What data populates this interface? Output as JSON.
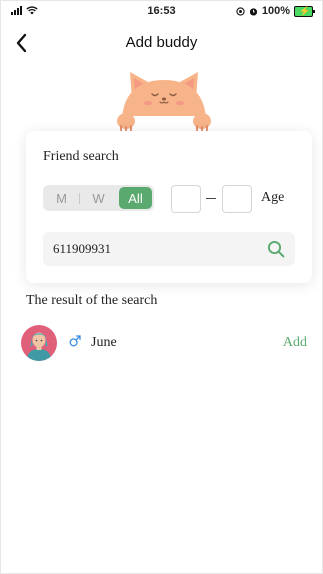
{
  "status_bar": {
    "time": "16:53",
    "battery": "100%",
    "icons": [
      "signal-icon",
      "wifi-icon",
      "location-icon",
      "alarm-icon",
      "battery-icon"
    ]
  },
  "nav": {
    "title": "Add buddy",
    "back_icon": "chevron-left-icon"
  },
  "search_card": {
    "title": "Friend search",
    "gender_options": [
      "M",
      "W",
      "All"
    ],
    "gender_selected": "All",
    "age_min": "",
    "age_max": "",
    "age_label": "Age",
    "search_value": "611909931",
    "search_icon": "search-icon"
  },
  "results": {
    "title": "The result of the search",
    "items": [
      {
        "name": "June",
        "gender_icon": "male-icon",
        "action_label": "Add"
      }
    ]
  },
  "colors": {
    "accent": "#5aa96e",
    "mascot": "#f7b489",
    "avatar_bg": "#e0607a"
  }
}
